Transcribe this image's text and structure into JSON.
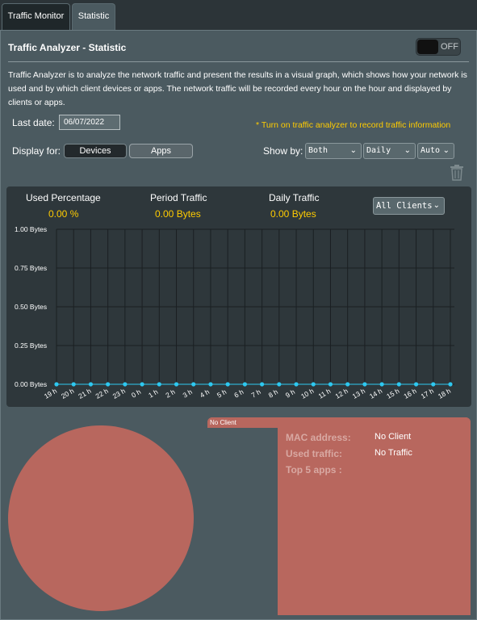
{
  "tabs": [
    {
      "label": "Traffic Monitor"
    },
    {
      "label": "Statistic"
    }
  ],
  "header": {
    "title": "Traffic Analyzer - Statistic",
    "toggle_label": "OFF"
  },
  "description": "Traffic Analyzer is to analyze the network traffic and present the results in a visual graph, which shows how your network is used and by which client devices or apps. The network traffic will be recorded every hour on the hour and displayed by clients or apps.",
  "controls": {
    "last_date_label": "Last date:",
    "last_date_value": "06/07/2022",
    "note": "* Turn on traffic analyzer to record traffic information",
    "display_for_label": "Display for:",
    "devices_label": "Devices",
    "apps_label": "Apps",
    "show_by_label": "Show by:",
    "show_by_values": [
      "Both",
      "Daily",
      "Auto"
    ],
    "trash_icon": "trash-icon"
  },
  "stats": {
    "used_percentage_label": "Used Percentage",
    "used_percentage_value": "0.00 %",
    "period_traffic_label": "Period Traffic",
    "period_traffic_value": "0.00 Bytes",
    "daily_traffic_label": "Daily Traffic",
    "daily_traffic_value": "0.00 Bytes",
    "client_filter": "All Clients"
  },
  "chart_data": {
    "type": "line",
    "categories": [
      "19 h",
      "20 h",
      "21 h",
      "22 h",
      "23 h",
      "0 h",
      "1 h",
      "2 h",
      "3 h",
      "4 h",
      "5 h",
      "6 h",
      "7 h",
      "8 h",
      "9 h",
      "10 h",
      "11 h",
      "12 h",
      "13 h",
      "14 h",
      "15 h",
      "16 h",
      "17 h",
      "18 h"
    ],
    "values": [
      0,
      0,
      0,
      0,
      0,
      0,
      0,
      0,
      0,
      0,
      0,
      0,
      0,
      0,
      0,
      0,
      0,
      0,
      0,
      0,
      0,
      0,
      0,
      0
    ],
    "y_ticks": [
      "1.00 Bytes",
      "0.75 Bytes",
      "0.50 Bytes",
      "0.25 Bytes",
      "0.00 Bytes"
    ],
    "ylim": [
      0,
      1
    ],
    "grid": true,
    "line_color": "#2ec8f0",
    "grid_color": "#1a1f22"
  },
  "client": {
    "tab_label": "No Client",
    "mac_label": "MAC address:",
    "mac_value": "No Client",
    "used_label": "Used traffic:",
    "used_value": "No Traffic",
    "top_apps_label": "Top 5 apps :"
  },
  "colors": {
    "accent": "#ffcc00",
    "pie": "#b8675e"
  }
}
